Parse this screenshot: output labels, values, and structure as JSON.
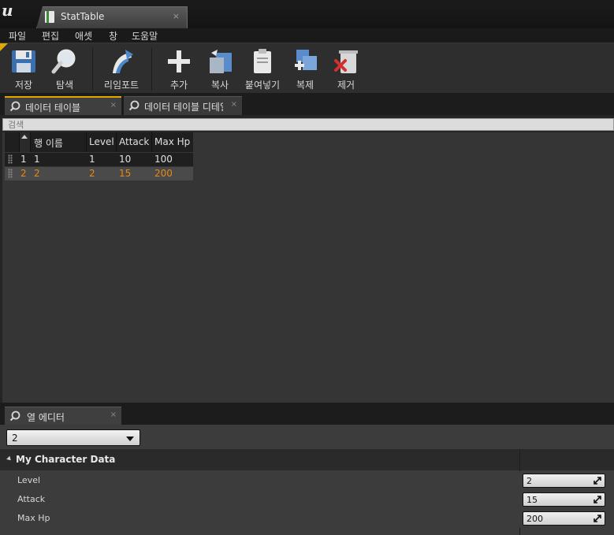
{
  "window": {
    "tab_title": "StatTable",
    "tab_close": "×"
  },
  "menu": [
    "파일",
    "편집",
    "애셋",
    "창",
    "도움말"
  ],
  "toolbar": {
    "save": "저장",
    "browse": "탐색",
    "reimport": "리임포트",
    "add": "추가",
    "copy": "복사",
    "paste": "붙여넣기",
    "duplicate": "복제",
    "remove": "제거"
  },
  "panels": {
    "data_table_tab": "데이터 테이블",
    "data_table_details_tab": "데이터 테이블 디테일",
    "close": "×"
  },
  "search": {
    "placeholder": "검색"
  },
  "table": {
    "headers": [
      "행 이름",
      "Level",
      "Attack",
      "Max Hp"
    ],
    "rows": [
      {
        "index": "1",
        "name": "1",
        "level": "1",
        "attack": "10",
        "max_hp": "100"
      },
      {
        "index": "2",
        "name": "2",
        "level": "2",
        "attack": "15",
        "max_hp": "200"
      }
    ]
  },
  "row_editor": {
    "tab": "열 에디터",
    "selected_row": "2",
    "category": "My Character Data",
    "properties": [
      {
        "label": "Level",
        "value": "2"
      },
      {
        "label": "Attack",
        "value": "15"
      },
      {
        "label": "Max Hp",
        "value": "200"
      }
    ]
  },
  "colors": {
    "accent": "#e0a800",
    "selected_row_text": "#e38a1a",
    "background": "#242424"
  }
}
